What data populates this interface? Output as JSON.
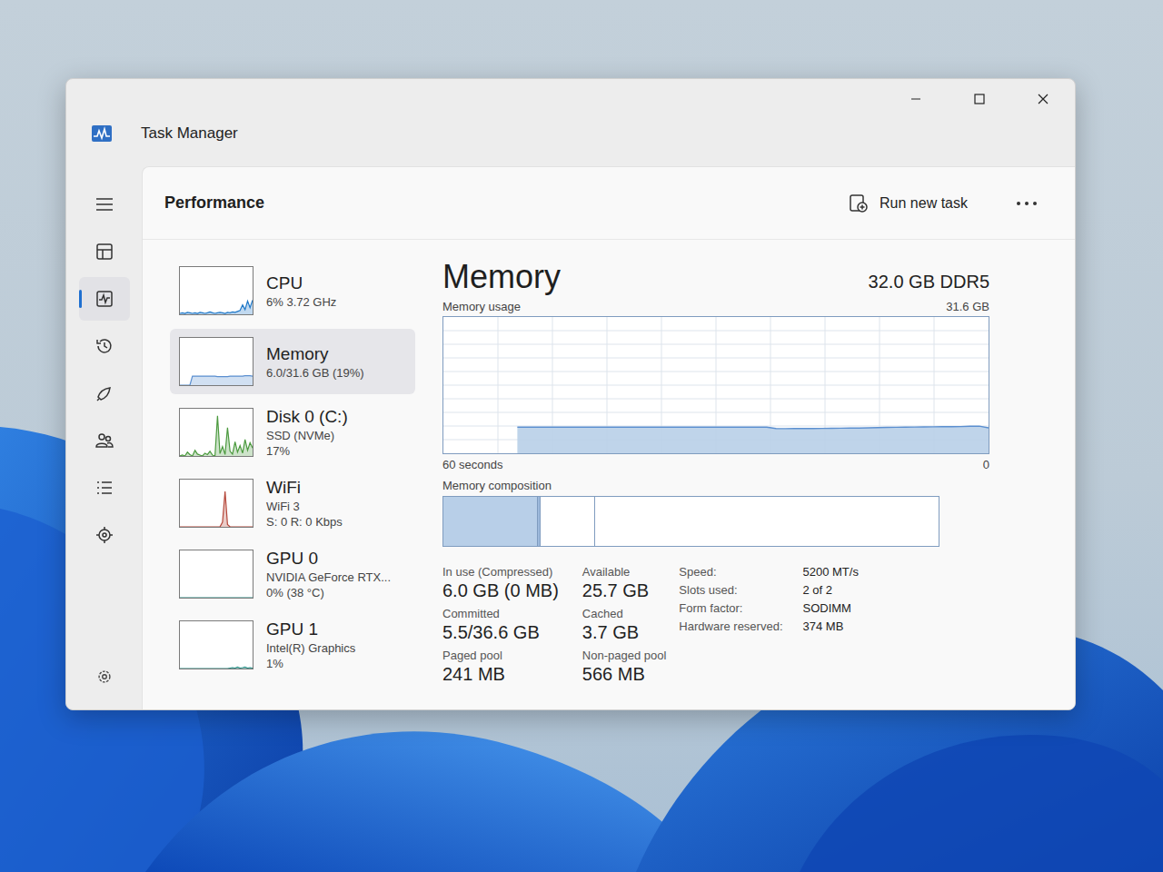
{
  "window": {
    "title": "Task Manager"
  },
  "nav": [
    {
      "kind": "menu",
      "selected": false
    },
    {
      "kind": "processes",
      "selected": false
    },
    {
      "kind": "performance",
      "selected": true
    },
    {
      "kind": "app-history",
      "selected": false
    },
    {
      "kind": "startup",
      "selected": false
    },
    {
      "kind": "users",
      "selected": false
    },
    {
      "kind": "details",
      "selected": false
    },
    {
      "kind": "services",
      "selected": false
    }
  ],
  "page": {
    "title": "Performance",
    "run_task": "Run new task"
  },
  "resources": [
    {
      "name": "CPU",
      "lines": [
        "6% 3.72 GHz"
      ],
      "selected": false,
      "color": "#1f78c8",
      "graph": [
        2,
        3,
        2,
        4,
        3,
        2,
        3,
        2,
        4,
        3,
        2,
        3,
        5,
        3,
        2,
        3,
        4,
        3,
        2,
        4,
        3,
        5,
        4,
        6,
        8,
        20,
        10,
        28,
        14,
        30
      ]
    },
    {
      "name": "Memory",
      "lines": [
        "6.0/31.6 GB (19%)"
      ],
      "selected": true,
      "color": "#5b8fd0",
      "graph": [
        0,
        0,
        0,
        0,
        0,
        19,
        19,
        19,
        19,
        19,
        19,
        19,
        19,
        19,
        19,
        18,
        18,
        18,
        18,
        18,
        19,
        19,
        19,
        19,
        19,
        19,
        20,
        20,
        20,
        19
      ]
    },
    {
      "name": "Disk 0 (C:)",
      "lines": [
        "SSD (NVMe)",
        "17%"
      ],
      "selected": false,
      "color": "#4c9a3f",
      "graph": [
        0,
        2,
        0,
        8,
        3,
        0,
        12,
        4,
        2,
        0,
        6,
        3,
        10,
        2,
        0,
        85,
        5,
        20,
        3,
        60,
        10,
        4,
        30,
        8,
        22,
        6,
        35,
        12,
        28,
        17
      ]
    },
    {
      "name": "WiFi",
      "lines": [
        "WiFi 3",
        "S: 0 R: 0 Kbps"
      ],
      "selected": false,
      "color": "#b5473a",
      "graph": [
        0,
        0,
        0,
        0,
        0,
        0,
        0,
        0,
        0,
        0,
        0,
        0,
        0,
        0,
        0,
        0,
        0,
        10,
        75,
        5,
        0,
        0,
        0,
        0,
        0,
        0,
        0,
        0,
        0,
        0
      ]
    },
    {
      "name": "GPU 0",
      "lines": [
        "NVIDIA GeForce RTX...",
        "0% (38 °C)"
      ],
      "selected": false,
      "color": "#2a8f86",
      "graph": [
        0,
        0,
        0,
        0,
        0,
        0,
        0,
        0,
        0,
        0,
        0,
        0,
        0,
        0,
        0,
        0,
        0,
        0,
        0,
        0,
        0,
        0,
        0,
        0,
        0,
        0,
        0,
        0,
        0,
        0
      ]
    },
    {
      "name": "GPU 1",
      "lines": [
        "Intel(R) Graphics",
        "1%"
      ],
      "selected": false,
      "color": "#2a8f86",
      "graph": [
        0,
        0,
        0,
        0,
        0,
        0,
        0,
        0,
        0,
        0,
        0,
        0,
        0,
        0,
        0,
        0,
        0,
        0,
        0,
        0,
        1,
        2,
        1,
        3,
        1,
        2,
        3,
        1,
        2,
        1
      ]
    }
  ],
  "detail": {
    "title": "Memory",
    "spec": "32.0 GB DDR5",
    "chart": {
      "label": "Memory usage",
      "max_label": "31.6 GB",
      "max": 31.6,
      "time_label": "60 seconds",
      "min_label": "0",
      "values": [
        6.05,
        6.05,
        6.05,
        6.05,
        6.05,
        6.05,
        6.05,
        6.05,
        6.05,
        6.05,
        6.05,
        6.05,
        6.05,
        6.05,
        6.05,
        6.05,
        6.05,
        6.05,
        6.05,
        6.05,
        6.05,
        6.05,
        6.05,
        6.05,
        6.05,
        6.05,
        6.05,
        6.05,
        5.75,
        5.7,
        5.72,
        5.74,
        5.76,
        5.78,
        5.8,
        5.82,
        5.84,
        5.86,
        5.9,
        5.95,
        6.0,
        6.02,
        6.05,
        6.08,
        6.1,
        6.12,
        6.15,
        6.18,
        6.2,
        6.25,
        6.3,
        5.9
      ]
    },
    "composition": {
      "label": "Memory composition",
      "segments": [
        {
          "kind": "in-use",
          "level": 0.19
        },
        {
          "kind": "modified",
          "level": 0.006
        },
        {
          "kind": "standby",
          "level": 0.11
        },
        {
          "kind": "free",
          "level": 0.694
        }
      ]
    },
    "stats": [
      {
        "label": "In use (Compressed)",
        "value": "6.0 GB (0 MB)"
      },
      {
        "label": "Available",
        "value": "25.7 GB"
      },
      {
        "label": "Committed",
        "value": "5.5/36.6 GB"
      },
      {
        "label": "Cached",
        "value": "3.7 GB"
      },
      {
        "label": "Paged pool",
        "value": "241 MB"
      },
      {
        "label": "Non-paged pool",
        "value": "566 MB"
      }
    ],
    "specs": [
      {
        "label": "Speed:",
        "value": "5200 MT/s"
      },
      {
        "label": "Slots used:",
        "value": "2 of 2"
      },
      {
        "label": "Form factor:",
        "value": "SODIMM"
      },
      {
        "label": "Hardware reserved:",
        "value": "374 MB"
      }
    ]
  }
}
